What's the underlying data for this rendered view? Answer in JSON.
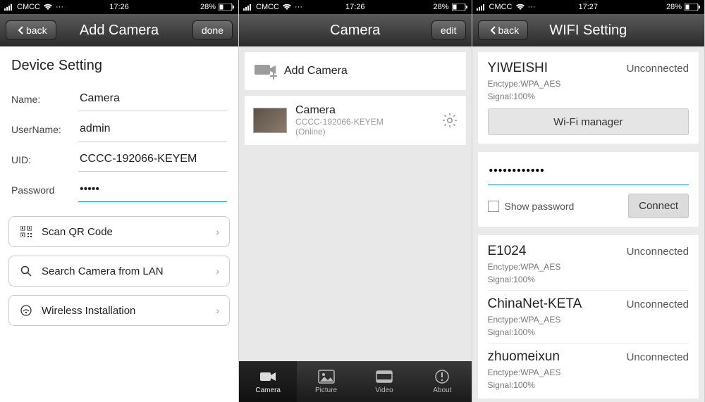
{
  "status": {
    "carrier": "CMCC",
    "battery": "28%",
    "dots": "···"
  },
  "screen1": {
    "time": "17:26",
    "nav": {
      "back": "back",
      "title": "Add Camera",
      "done": "done"
    },
    "section_title": "Device Setting",
    "fields": {
      "name_label": "Name:",
      "name_value": "Camera",
      "user_label": "UserName:",
      "user_value": "admin",
      "uid_label": "UID:",
      "uid_value": "CCCC-192066-KEYEM",
      "pwd_label": "Password",
      "pwd_value": "•••••"
    },
    "actions": {
      "qr": "Scan QR Code",
      "lan": "Search Camera from LAN",
      "wireless": "Wireless Installation"
    }
  },
  "screen2": {
    "time": "17:26",
    "nav": {
      "title": "Camera",
      "edit": "edit"
    },
    "add_label": "Add Camera",
    "cam": {
      "name": "Camera",
      "uid": "CCCC-192066-KEYEM",
      "status": "(Online)"
    },
    "tabs": {
      "camera": "Camera",
      "picture": "Picture",
      "video": "Video",
      "about": "About"
    }
  },
  "screen3": {
    "time": "17:27",
    "nav": {
      "back": "back",
      "title": "WIFI Setting"
    },
    "current": {
      "ssid": "YIWEISHI",
      "state": "Unconnected",
      "enctype": "Enctype:WPA_AES",
      "signal": "Signal:100%",
      "mgr_btn": "Wi-Fi manager"
    },
    "password": {
      "value": "••••••••••••",
      "show_label": "Show password",
      "connect": "Connect"
    },
    "networks": [
      {
        "ssid": "E1024",
        "state": "Unconnected",
        "enctype": "Enctype:WPA_AES",
        "signal": "Signal:100%"
      },
      {
        "ssid": "ChinaNet-KETA",
        "state": "Unconnected",
        "enctype": "Enctype:WPA_AES",
        "signal": "Signal:100%"
      },
      {
        "ssid": "zhuomeixun",
        "state": "Unconnected",
        "enctype": "Enctype:WPA_AES",
        "signal": "Signal:100%"
      }
    ]
  }
}
